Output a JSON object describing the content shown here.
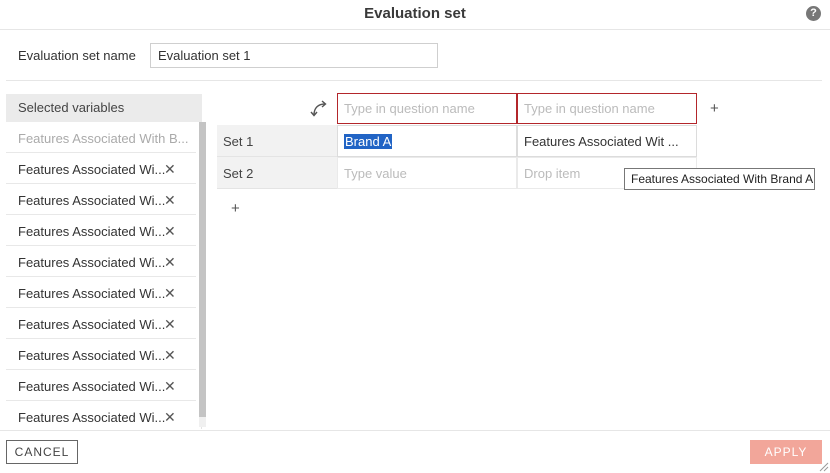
{
  "dialog": {
    "title": "Evaluation set",
    "help_icon": "?"
  },
  "name_field": {
    "label": "Evaluation set name",
    "value": "Evaluation set 1"
  },
  "variables": {
    "header": "Selected variables",
    "items": [
      {
        "label": "Features Associated With B...",
        "removable": false
      },
      {
        "label": "Features Associated Wi...",
        "removable": true
      },
      {
        "label": "Features Associated Wi...",
        "removable": true
      },
      {
        "label": "Features Associated Wi...",
        "removable": true
      },
      {
        "label": "Features Associated Wi...",
        "removable": true
      },
      {
        "label": "Features Associated Wi...",
        "removable": true
      },
      {
        "label": "Features Associated Wi...",
        "removable": true
      },
      {
        "label": "Features Associated Wi...",
        "removable": true
      },
      {
        "label": "Features Associated Wi...",
        "removable": true
      },
      {
        "label": "Features Associated Wi...",
        "removable": true
      }
    ],
    "remove_glyph": "✕"
  },
  "grid": {
    "column_headers": [
      {
        "placeholder": "Type in question name"
      },
      {
        "placeholder": "Type in question name"
      }
    ],
    "add_column_glyph": "+",
    "add_row_glyph": "+",
    "rows": [
      {
        "label": "Set 1",
        "cells": [
          "Brand A",
          "Features Associated Wit ..."
        ]
      },
      {
        "label": "Set 2",
        "cells": [
          "Type value",
          "Drop item"
        ]
      }
    ]
  },
  "tooltip": "Features Associated With Brand A",
  "footer": {
    "cancel_label": "CANCEL",
    "apply_label": "APPLY"
  },
  "colors": {
    "accent_border": "#b3262b",
    "apply_disabled": "#f2a69a",
    "selection": "#2164c5"
  }
}
